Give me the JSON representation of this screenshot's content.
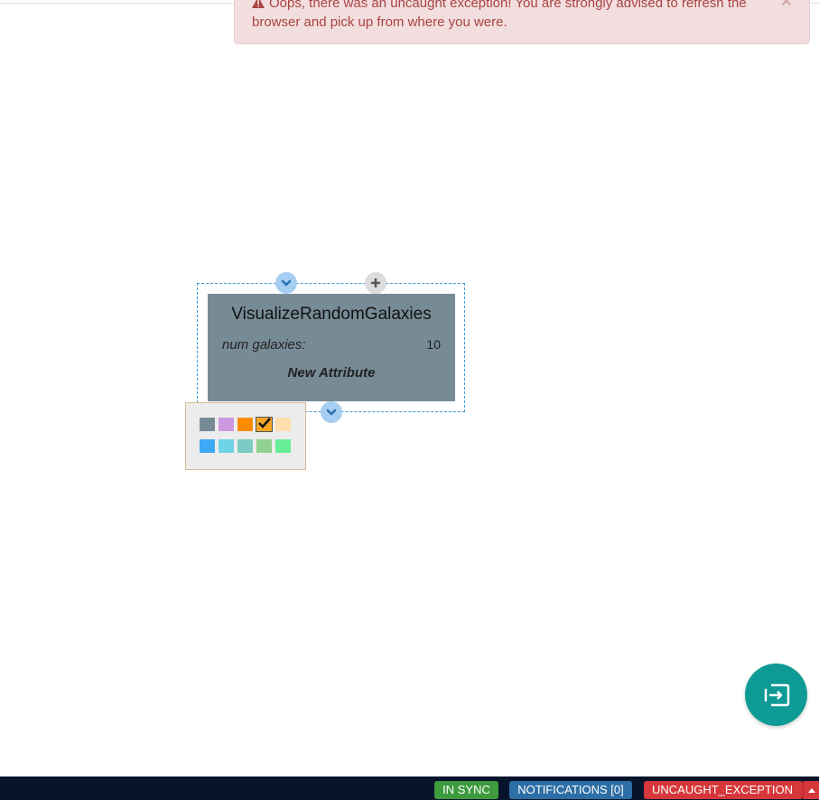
{
  "alert": {
    "message": "Oops, there was an uncaught exception! You are strongly advised to refresh the browser and pick up from where you were.",
    "close_label": "×"
  },
  "node": {
    "title": "VisualizeRandomGalaxies",
    "attributes": [
      {
        "name": "num galaxies:",
        "value": "10"
      }
    ],
    "new_attribute_label": "New Attribute",
    "color": "#778b96"
  },
  "color_picker": {
    "colors": [
      "#778b96",
      "#cc99e0",
      "#ff8c00",
      "#f5a623",
      "#ffdead",
      "#3fa9f5",
      "#6fd4e8",
      "#7ccbc4",
      "#90d090",
      "#66ee99"
    ],
    "selected_index": 3
  },
  "statusbar": {
    "sync_label": "IN SYNC",
    "notifications_label": "NOTIFICATIONS [0]",
    "error_label": "UNCAUGHT_EXCEPTION"
  },
  "icons": {
    "alert": "warning-icon",
    "collapse": "chevron-down-icon",
    "add": "plus-icon",
    "fab": "exit-icon",
    "caret": "caret-up-icon"
  }
}
